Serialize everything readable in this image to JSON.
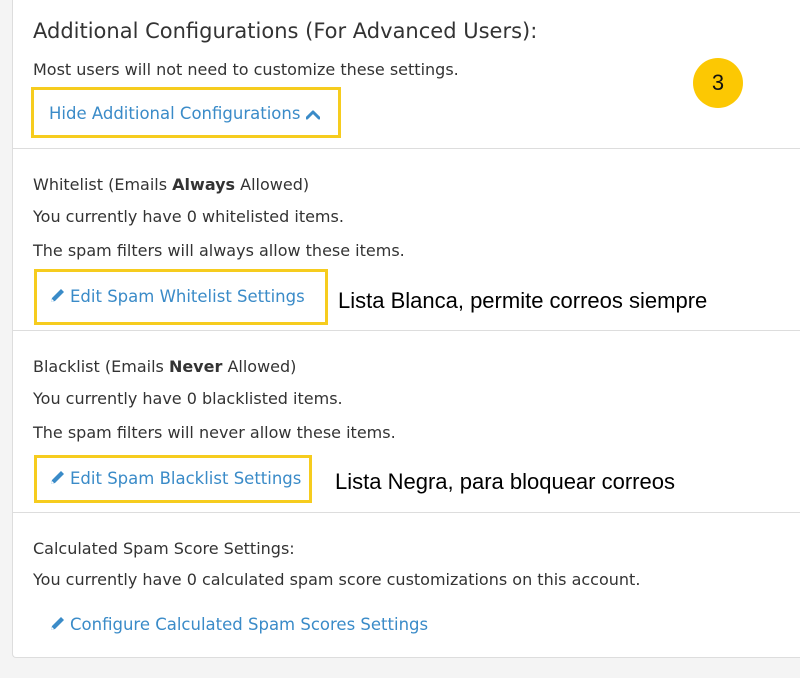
{
  "header": {
    "title": "Additional Configurations (For Advanced Users):",
    "subtitle": "Most users will not need to customize these settings.",
    "hide_link": "Hide Additional Configurations"
  },
  "badge": "3",
  "whitelist": {
    "heading_pre": "Whitelist (Emails ",
    "heading_bold": "Always",
    "heading_post": " Allowed)",
    "count_text": "You currently have 0 whitelisted items.",
    "desc": "The spam filters will always allow these items.",
    "edit_link": "Edit Spam Whitelist Settings",
    "annotation": "Lista Blanca, permite correos siempre"
  },
  "blacklist": {
    "heading_pre": "Blacklist (Emails ",
    "heading_bold": "Never",
    "heading_post": " Allowed)",
    "count_text": "You currently have 0 blacklisted items.",
    "desc": "The spam filters will never allow these items.",
    "edit_link": "Edit Spam Blacklist Settings",
    "annotation": "Lista Negra, para bloquear correos"
  },
  "score": {
    "heading": "Calculated Spam Score Settings:",
    "count_text": "You currently have 0 calculated spam score customizations on this account.",
    "config_link": "Configure Calculated Spam Scores Settings"
  },
  "colors": {
    "link": "#3a8bc8",
    "highlight": "#f6cc1e",
    "badge": "#fcc803"
  }
}
